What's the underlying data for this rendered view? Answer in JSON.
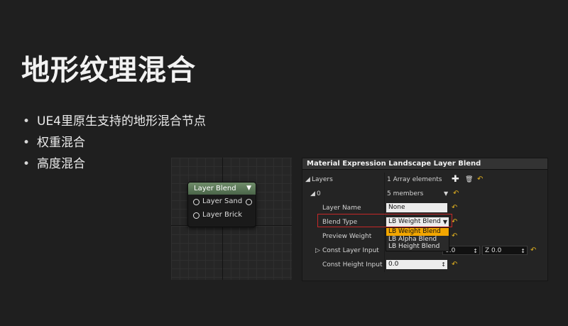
{
  "slide": {
    "title": "地形纹理混合",
    "bullets": [
      "UE4里原生支持的地形混合节点",
      "权重混合",
      "高度混合"
    ]
  },
  "graph": {
    "node": {
      "title": "Layer Blend",
      "pins": [
        "Layer Sand",
        "Layer Brick"
      ]
    }
  },
  "details": {
    "title": "Material Expression Landscape Layer Blend",
    "layers_label": "Layers",
    "layers_value": "1 Array elements",
    "item_index": "0",
    "item_value": "5 members",
    "layer_name_label": "Layer Name",
    "layer_name_value": "None",
    "blend_type_label": "Blend Type",
    "blend_type_value": "LB Weight Blend",
    "preview_weight_label": "Preview Weight",
    "const_layer_input_label": "Const Layer Input",
    "const_layer_y_value": "0.0",
    "const_layer_z_label": "Z",
    "const_layer_z_value": "0.0",
    "const_height_input_label": "Const Height Input",
    "const_height_value": "0.0",
    "dropdown_options": [
      "LB Weight Blend",
      "LB Alpha Blend",
      "LB Height Blend"
    ]
  },
  "colors": {
    "background": "#1f1f1f",
    "node_header": "#5c7a58",
    "highlight_border": "#c62828",
    "selected_option": "#f2a600",
    "reset_arrow": "#e0b020"
  }
}
